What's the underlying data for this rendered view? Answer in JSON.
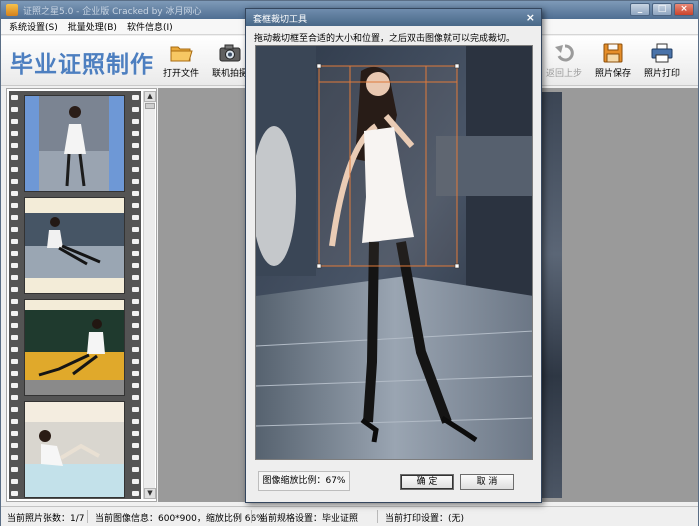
{
  "main_window": {
    "title": "证照之星5.0 - 企业版 Cracked by 冰月网心",
    "controls": {
      "minimize": "_",
      "maximize": "□",
      "close": "×"
    }
  },
  "menu": {
    "items": [
      "系统设置(S)",
      "批量处理(B)",
      "软件信息(I)"
    ]
  },
  "toolbar": {
    "brand": "毕业证照制作",
    "buttons": [
      {
        "label": "打开文件",
        "icon": "folder-open-icon",
        "enabled": true
      },
      {
        "label": "联机拍摄",
        "icon": "camera-icon",
        "enabled": true
      },
      {
        "label": "返回上步",
        "icon": "undo-icon",
        "enabled": false
      },
      {
        "label": "照片保存",
        "icon": "save-icon",
        "enabled": true
      },
      {
        "label": "照片打印",
        "icon": "printer-icon",
        "enabled": true
      }
    ]
  },
  "filmstrip": {
    "frame_count": 4,
    "scroll": {
      "up": "▲",
      "down": "▼"
    }
  },
  "status": {
    "photo_count": "当前照片张数：1/7",
    "image_info": "当前图像信息：600*900，缩放比例 66%",
    "spec": "当前规格设置：毕业证照",
    "print": "当前打印设置：(无)"
  },
  "dialog": {
    "title": "套框裁切工具",
    "close": "×",
    "instruction": "拖动裁切框至合适的大小和位置，之后双击图像就可以完成裁切。",
    "zoom_label": "图像缩放比例：67%",
    "ok_label": "确 定",
    "cancel_label": "取 消"
  },
  "colors": {
    "brand": "#4d7fc0",
    "crop_frame": "#e07a3a",
    "titlebar": "#4f6e92"
  }
}
